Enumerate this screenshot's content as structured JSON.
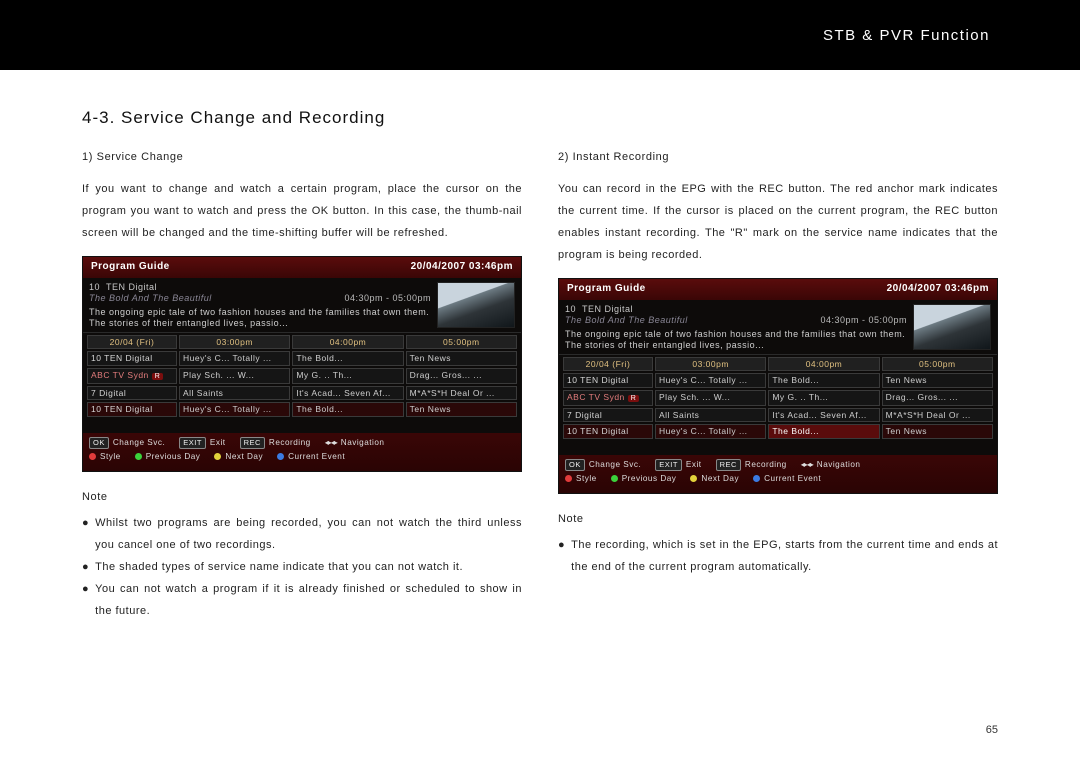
{
  "header": {
    "title": "STB & PVR Function"
  },
  "page_title": "4-3. Service Change and Recording",
  "page_number": "65",
  "left": {
    "subhead": "1) Service Change",
    "body": "If you want to change and watch a certain program, place the cursor on the program you want to watch and press the OK button. In this case, the thumb-nail screen will be changed and the time-shifting buffer will be refreshed.",
    "note_head": "Note",
    "bullets": [
      "Whilst two programs are being recorded, you can not watch the third unless you cancel one of two recordings.",
      "The shaded types of service name indicate that you can not watch it.",
      "You can not watch a program if it is already finished or scheduled to show in the future."
    ]
  },
  "right": {
    "subhead": "2) Instant Recording",
    "body": "You can record in the EPG with the REC button. The red anchor mark indicates the current time. If the cursor is placed on the current program, the REC button enables instant recording. The \"R\" mark on the service name indicates that the program is being recorded.",
    "note_head": "Note",
    "bullets": [
      "The recording, which is set in the EPG, starts from the current time and ends at the end of the current program automatically."
    ]
  },
  "epg": {
    "title": "Program Guide",
    "datetime": "20/04/2007   03:46pm",
    "channel_no": "10",
    "channel_name": "TEN Digital",
    "program": "The Bold And The Beautiful",
    "times": "04:30pm - 05:00pm",
    "description": "The ongoing epic tale of two fashion houses and the families that own them. The stories of their entangled lives, passio...",
    "grid_head": [
      "20/04 (Fri)",
      "03:00pm",
      "04:00pm",
      "05:00pm"
    ],
    "footer": {
      "row1": [
        {
          "kbd": "OK",
          "label": "Change Svc."
        },
        {
          "kbd": "EXIT",
          "label": "Exit"
        },
        {
          "kbd": "REC",
          "label": "Recording"
        },
        {
          "arrows": "◂▸◂▸",
          "label": "Navigation"
        }
      ],
      "row2": [
        {
          "color": "red",
          "label": "Style"
        },
        {
          "color": "green",
          "label": "Previous Day"
        },
        {
          "color": "yellow",
          "label": "Next Day"
        },
        {
          "color": "blue",
          "label": "Current Event"
        }
      ]
    }
  },
  "epg_left_rows": [
    {
      "svc": "10 TEN Digital",
      "c1": "Huey's C...  Totally ...",
      "c2": "The Bold...",
      "c3": "Ten News",
      "sel_row": false
    },
    {
      "svc": "ABC TV Sydn",
      "rec": true,
      "c1": "Play Sch. ...  W...",
      "c2": "My G. ..  Th...",
      "c3": "Drag...  Gros...  ...",
      "sel_row": false
    },
    {
      "svc": "7 Digital",
      "c1": "All Saints",
      "c2": "It's Acad...  Seven Af...",
      "c3": "M*A*S*H  Deal Or ...",
      "sel_row": false
    },
    {
      "svc": "10 TEN Digital",
      "c1": "Huey's C...  Totally ...",
      "c2": "The Bold...",
      "c3": "Ten News",
      "sel_row": true,
      "sel_col": -1
    }
  ],
  "epg_right_rows": [
    {
      "svc": "10 TEN Digital",
      "c1": "Huey's C...  Totally ...",
      "c2": "The Bold...",
      "c3": "Ten News",
      "sel_row": false
    },
    {
      "svc": "ABC TV Sydn",
      "rec": true,
      "c1": "Play Sch. ...  W...",
      "c2": "My G. ..  Th...",
      "c3": "Drag...  Gros...  ...",
      "sel_row": false
    },
    {
      "svc": "7 Digital",
      "c1": "All Saints",
      "c2": "It's Acad...  Seven Af...",
      "c3": "M*A*S*H  Deal Or ...",
      "sel_row": false
    },
    {
      "svc": "10 TEN Digital",
      "c1": "Huey's C...  Totally ...",
      "c2": "The Bold...",
      "c3": "Ten News",
      "sel_row": true,
      "sel_col": 2
    }
  ]
}
